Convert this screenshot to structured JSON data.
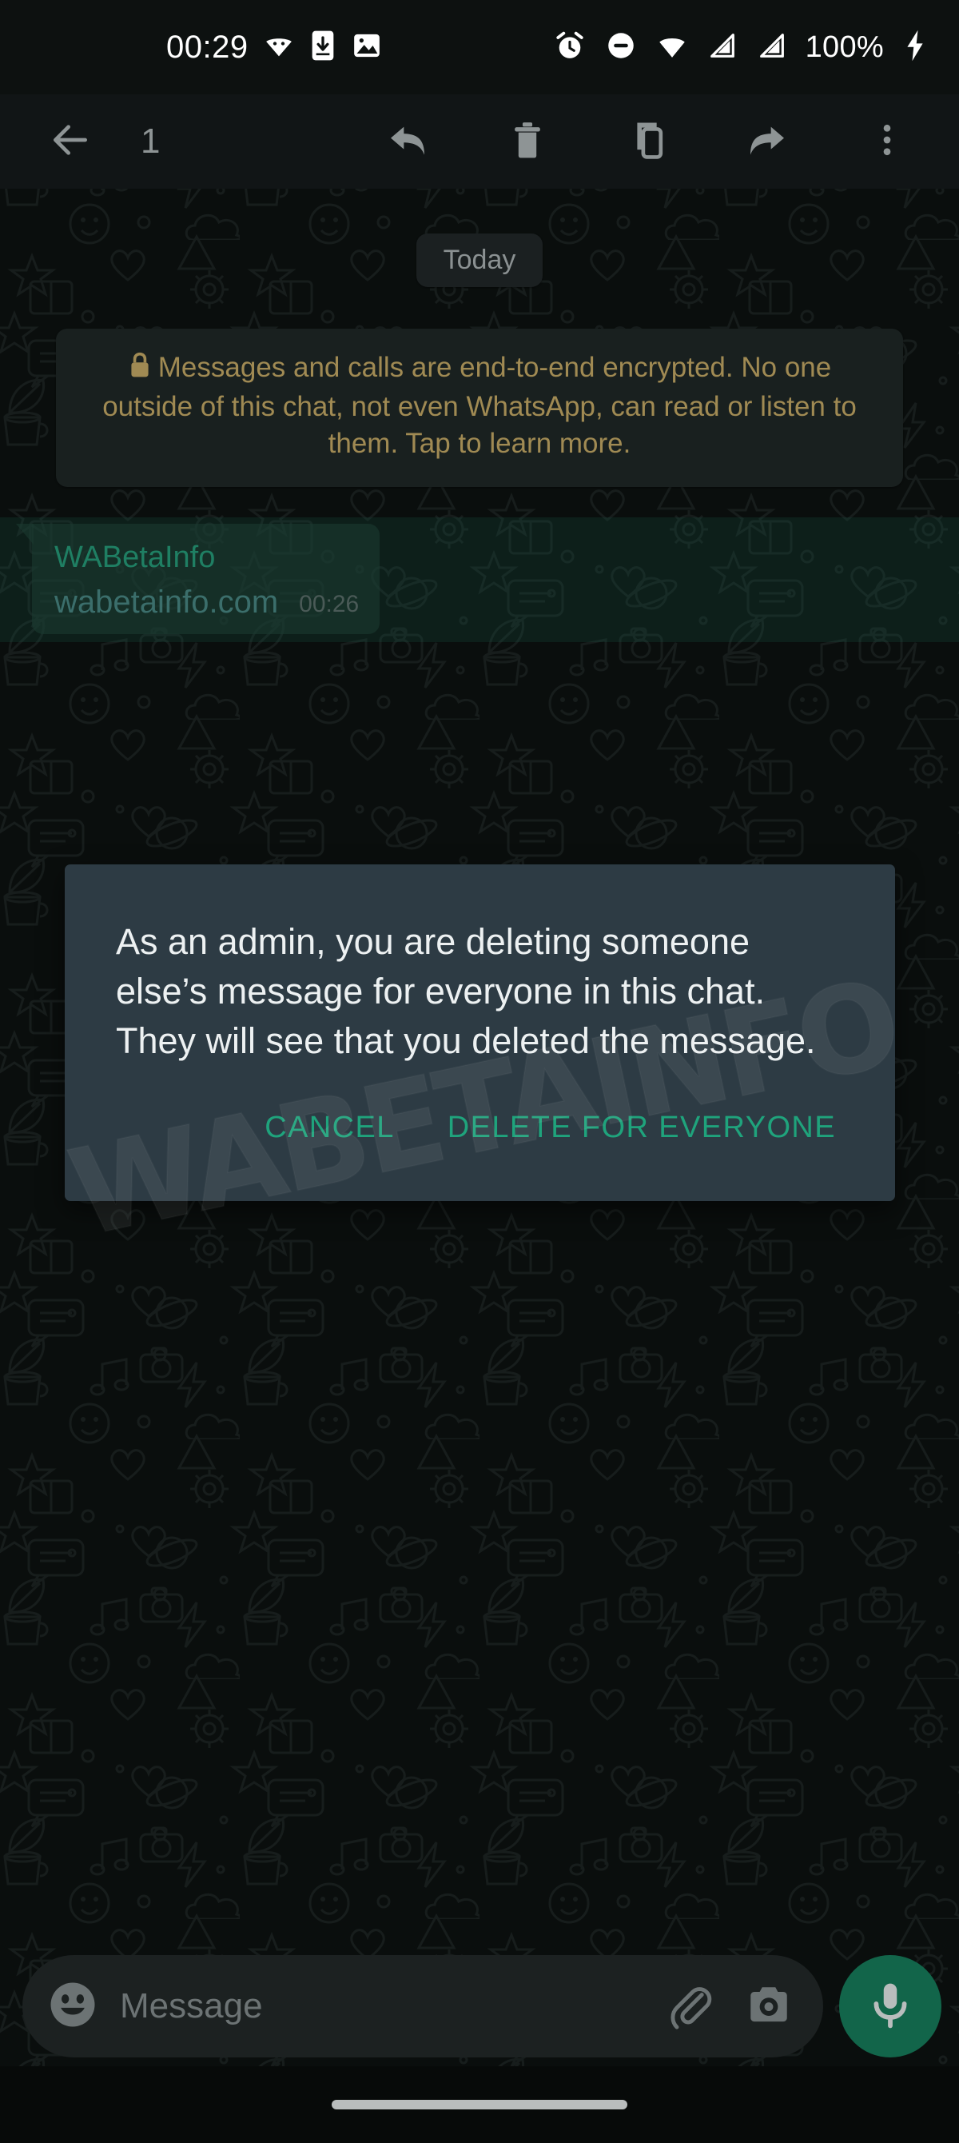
{
  "status_bar": {
    "time": "00:29",
    "battery_percent": "100%",
    "icons": [
      "android-wifi-debug-icon",
      "phone-download-icon",
      "image-icon",
      "alarm-icon",
      "do-not-disturb-icon",
      "wifi-icon",
      "signal-sim1-icon",
      "signal-sim2-icon",
      "charging-bolt-icon"
    ]
  },
  "action_bar": {
    "back_label": "back-arrow-icon",
    "selected_count": "1",
    "actions": [
      {
        "name": "reply",
        "icon": "reply-arrow-icon"
      },
      {
        "name": "delete",
        "icon": "trash-icon"
      },
      {
        "name": "copy",
        "icon": "copy-icon"
      },
      {
        "name": "forward",
        "icon": "forward-arrow-icon"
      },
      {
        "name": "overflow",
        "icon": "more-vertical-icon"
      }
    ]
  },
  "chat": {
    "day_divider": "Today",
    "encryption_notice": "Messages and calls are end-to-end encrypted. No one outside of this chat, not even WhatsApp, can read or listen to them. Tap to learn more.",
    "message": {
      "sender": "WABetaInfo",
      "text": "wabetainfo.com",
      "time": "00:26",
      "selected": true
    }
  },
  "dialog": {
    "body": "As an admin, you are deleting someone else’s message for everyone in this chat. They will see that you deleted the message.",
    "cancel_label": "CANCEL",
    "confirm_label": "DELETE FOR EVERYONE"
  },
  "watermark": {
    "text": "WABETAINFO"
  },
  "composer": {
    "placeholder": "Message",
    "value": "",
    "emoji_icon": "emoji-smiley-icon",
    "attach_icon": "paperclip-icon",
    "camera_icon": "camera-icon",
    "mic_icon": "microphone-icon"
  },
  "colors": {
    "accent_green": "#1fa37c",
    "dialog_bg": "#2d3b44",
    "bubble_bg": "#1c3a31",
    "sender_green": "#1f7f63",
    "encryption_text": "#a08a53",
    "fab_green": "#12654a"
  }
}
